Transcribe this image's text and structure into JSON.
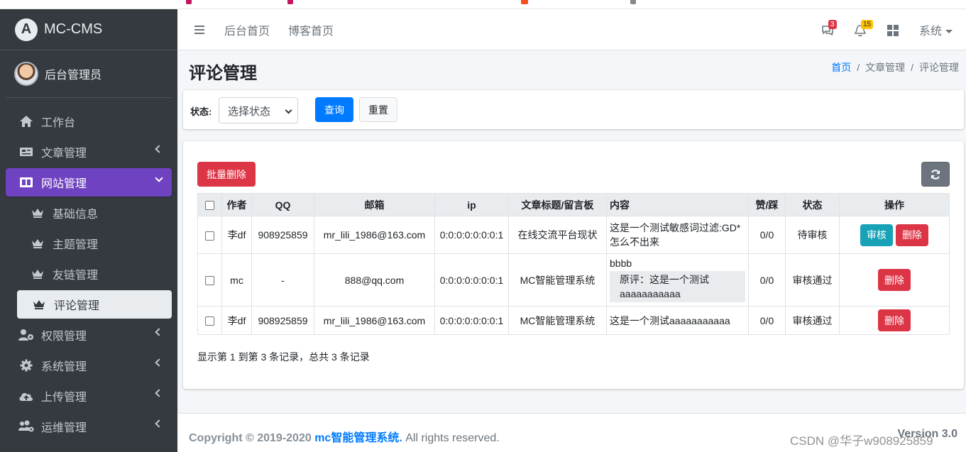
{
  "app": {
    "brand": "MC-CMS",
    "user_name": "后台管理员"
  },
  "sidebar": {
    "items": [
      {
        "label": "工作台",
        "icon": "home-icon"
      },
      {
        "label": "文章管理",
        "icon": "newspaper-icon"
      },
      {
        "label": "网站管理",
        "icon": "columns-icon"
      },
      {
        "label": "基础信息",
        "icon": "crown-icon"
      },
      {
        "label": "主题管理",
        "icon": "crown-icon"
      },
      {
        "label": "友链管理",
        "icon": "crown-icon"
      },
      {
        "label": "评论管理",
        "icon": "crown-icon"
      },
      {
        "label": "权限管理",
        "icon": "user-cog-icon"
      },
      {
        "label": "系统管理",
        "icon": "gear-icon"
      },
      {
        "label": "上传管理",
        "icon": "cloud-upload-icon"
      },
      {
        "label": "运维管理",
        "icon": "users-cog-icon"
      }
    ]
  },
  "topbar": {
    "links": [
      "后台首页",
      "博客首页"
    ],
    "messages_badge": "3",
    "notifications_badge": "15",
    "system_label": "系统"
  },
  "page": {
    "title": "评论管理",
    "breadcrumb": {
      "home": "首页",
      "section": "文章管理",
      "current": "评论管理",
      "separator": "/"
    }
  },
  "filter": {
    "status_label": "状态:",
    "status_placeholder": "选择状态",
    "query_button": "查询",
    "reset_button": "重置"
  },
  "table": {
    "bulk_delete": "批量删除",
    "columns": [
      "作者",
      "QQ",
      "邮箱",
      "ip",
      "文章标题/留言板",
      "内容",
      "赞/踩",
      "状态",
      "操作"
    ],
    "rows": [
      {
        "author": "李df",
        "qq": "908925859",
        "email": "mr_lili_1986@163.com",
        "ip": "0:0:0:0:0:0:0:1",
        "article": "在线交流平台现状",
        "content": "这是一个测试敏感词过滤:GD* 怎么不出来",
        "quote": "",
        "votes": "0/0",
        "status": "待审核",
        "actions": [
          "审核",
          "删除"
        ]
      },
      {
        "author": "mc",
        "qq": "-",
        "email": "888@qq.com",
        "ip": "0:0:0:0:0:0:0:1",
        "article": "MC智能管理系统",
        "content": "bbbb",
        "quote": "原评：这是一个测试aaaaaaaaaaa",
        "votes": "0/0",
        "status": "审核通过",
        "actions": [
          "删除"
        ]
      },
      {
        "author": "李df",
        "qq": "908925859",
        "email": "mr_lili_1986@163.com",
        "ip": "0:0:0:0:0:0:0:1",
        "article": "MC智能管理系统",
        "content": "这是一个测试aaaaaaaaaaa",
        "quote": "",
        "votes": "0/0",
        "status": "审核通过",
        "actions": [
          "删除"
        ]
      }
    ],
    "summary": "显示第 1 到第 3 条记录，总共 3 条记录"
  },
  "footer": {
    "copyright": "Copyright © 2019-2020",
    "brand_link": "mc智能管理系统.",
    "rights": "All rights reserved.",
    "version": "Version 3.0"
  },
  "watermark": "CSDN @华子w908925859",
  "colors": {
    "sidebar_bg": "#343a40",
    "active_menu": "#6f42c1",
    "primary": "#007bff",
    "danger": "#dc3545",
    "info": "#17a2b8"
  }
}
